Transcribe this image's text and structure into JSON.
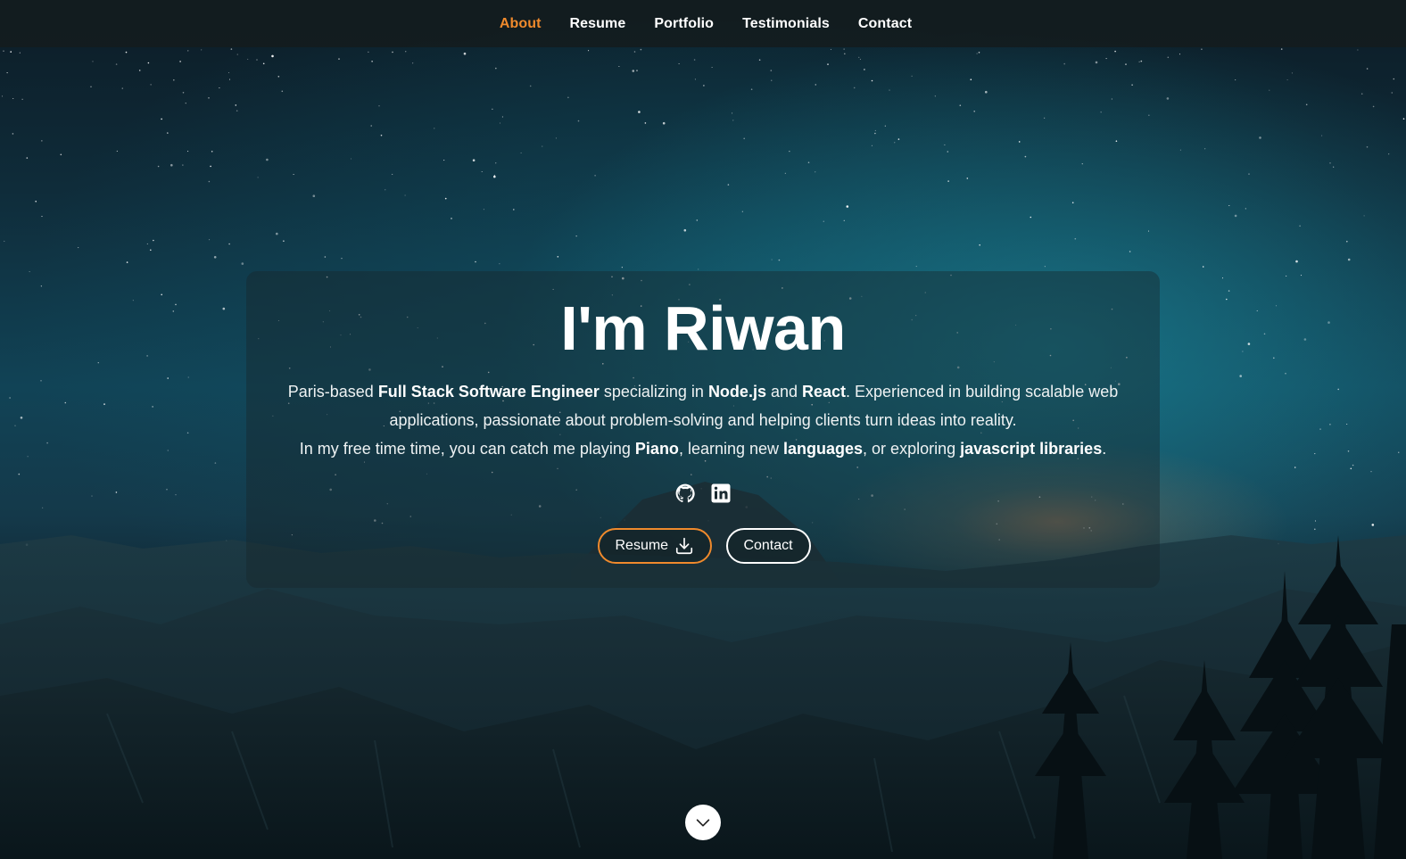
{
  "nav": {
    "items": [
      {
        "label": "About",
        "active": true
      },
      {
        "label": "Resume",
        "active": false
      },
      {
        "label": "Portfolio",
        "active": false
      },
      {
        "label": "Testimonials",
        "active": false
      },
      {
        "label": "Contact",
        "active": false
      }
    ]
  },
  "hero": {
    "title": "I'm Riwan",
    "bio": {
      "line1": [
        {
          "text": "Paris-based ",
          "bold": false
        },
        {
          "text": "Full Stack Software Engineer",
          "bold": true
        },
        {
          "text": " specializing in ",
          "bold": false
        },
        {
          "text": "Node.js",
          "bold": true
        },
        {
          "text": " and ",
          "bold": false
        },
        {
          "text": "React",
          "bold": true
        },
        {
          "text": ". Experienced in building scalable web applications, passionate about problem-solving and helping clients turn ideas into reality.",
          "bold": false
        }
      ],
      "line2": [
        {
          "text": "In my free time time, you can catch me playing ",
          "bold": false
        },
        {
          "text": "Piano",
          "bold": true
        },
        {
          "text": ", learning new ",
          "bold": false
        },
        {
          "text": "languages",
          "bold": true
        },
        {
          "text": ", or exploring ",
          "bold": false
        },
        {
          "text": "javascript libraries",
          "bold": true
        },
        {
          "text": ".",
          "bold": false
        }
      ]
    },
    "socials": [
      {
        "icon": "github-icon"
      },
      {
        "icon": "linkedin-icon"
      }
    ],
    "buttons": {
      "resume_label": "Resume",
      "contact_label": "Contact"
    }
  },
  "colors": {
    "accent": "#f08a2c",
    "nav_bg": "#141c1e",
    "text": "#ffffff"
  }
}
